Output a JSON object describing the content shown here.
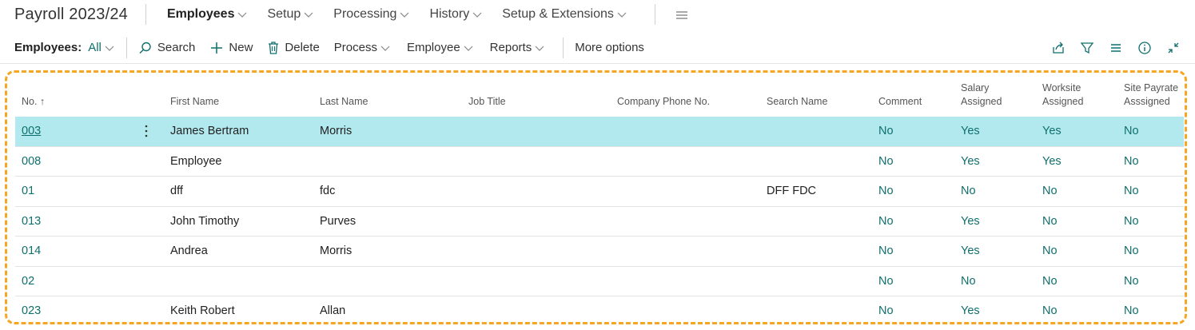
{
  "topnav": {
    "title": "Payroll 2023/24",
    "items": [
      {
        "label": "Employees",
        "active": true
      },
      {
        "label": "Setup"
      },
      {
        "label": "Processing"
      },
      {
        "label": "History"
      },
      {
        "label": "Setup & Extensions"
      }
    ],
    "menu_icon": "hamburger-icon"
  },
  "actionbar": {
    "view_label": "Employees:",
    "view_filter": "All",
    "actions": {
      "search": "Search",
      "new": "New",
      "delete": "Delete",
      "process": "Process",
      "employee": "Employee",
      "reports": "Reports",
      "more": "More options"
    },
    "right_icons": [
      "share-icon",
      "filter-icon",
      "list-view-icon",
      "info-icon",
      "collapse-icon"
    ]
  },
  "grid": {
    "headers": {
      "no": "No. ↑",
      "first": "First Name",
      "last": "Last Name",
      "job": "Job Title",
      "phone": "Company Phone No.",
      "search": "Search Name",
      "comment": "Comment",
      "salary_l1": "Salary",
      "salary_l2": "Assigned",
      "worksite_l1": "Worksite",
      "worksite_l2": "Assigned",
      "sitepay_l1": "Site Payrate",
      "sitepay_l2": "Asssigned"
    },
    "rows": [
      {
        "no": "003",
        "first": "James Bertram",
        "last": "Morris",
        "job": "",
        "phone": "",
        "search": "",
        "comment": "No",
        "salary": "Yes",
        "worksite": "Yes",
        "sitepay": "No"
      },
      {
        "no": "008",
        "first": "Employee",
        "last": "",
        "job": "",
        "phone": "",
        "search": "",
        "comment": "No",
        "salary": "Yes",
        "worksite": "Yes",
        "sitepay": "No"
      },
      {
        "no": "01",
        "first": "dff",
        "last": "fdc",
        "job": "",
        "phone": "",
        "search": "DFF FDC",
        "comment": "No",
        "salary": "No",
        "worksite": "No",
        "sitepay": "No"
      },
      {
        "no": "013",
        "first": "John Timothy",
        "last": "Purves",
        "job": "",
        "phone": "",
        "search": "",
        "comment": "No",
        "salary": "Yes",
        "worksite": "No",
        "sitepay": "No"
      },
      {
        "no": "014",
        "first": "Andrea",
        "last": "Morris",
        "job": "",
        "phone": "",
        "search": "",
        "comment": "No",
        "salary": "Yes",
        "worksite": "No",
        "sitepay": "No"
      },
      {
        "no": "02",
        "first": "",
        "last": "",
        "job": "",
        "phone": "",
        "search": "",
        "comment": "No",
        "salary": "No",
        "worksite": "No",
        "sitepay": "No"
      },
      {
        "no": "023",
        "first": "Keith Robert",
        "last": "Allan",
        "job": "",
        "phone": "",
        "search": "",
        "comment": "No",
        "salary": "Yes",
        "worksite": "No",
        "sitepay": "No"
      }
    ]
  },
  "colors": {
    "accent": "#0f6f6c",
    "selected_row": "#b2e9ee",
    "highlight_border": "#f5a623"
  }
}
